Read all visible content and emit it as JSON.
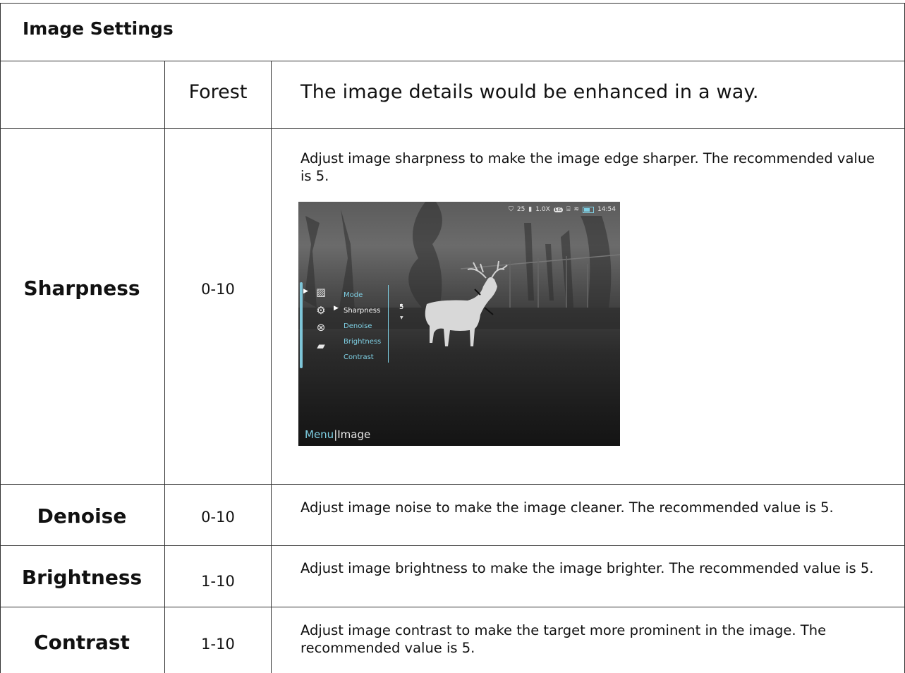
{
  "title": "Image Settings",
  "mode_row": {
    "name": "Forest",
    "description": "The image details would be enhanced in a way."
  },
  "rows": [
    {
      "name": "Sharpness",
      "range": "0-10",
      "description": "Adjust image sharpness to make the image edge sharper. The recommended value is 5."
    },
    {
      "name": "Denoise",
      "range": "0-10",
      "description": "Adjust image noise to make the image cleaner. The recommended value is 5."
    },
    {
      "name": "Brightness",
      "range": "1-10",
      "description": "Adjust image brightness to make the image brighter. The recommended value is 5."
    },
    {
      "name": "Contrast",
      "range": "1-10",
      "description": "Adjust image contrast to make the target more prominent in the image. The recommended value is 5."
    }
  ],
  "screenshot": {
    "status": {
      "shield_icon": "shield-icon",
      "timer": "25",
      "zoom": "1.0X",
      "eis": "EIS",
      "time": "14:54"
    },
    "menu_items": [
      "Mode",
      "Sharpness",
      "Denoise",
      "Brightness",
      "Contrast"
    ],
    "selected_item": "Sharpness",
    "selected_value": "5",
    "bottom_menu": "Menu",
    "bottom_sub": "Image",
    "accent_color": "#7ecfe3"
  }
}
